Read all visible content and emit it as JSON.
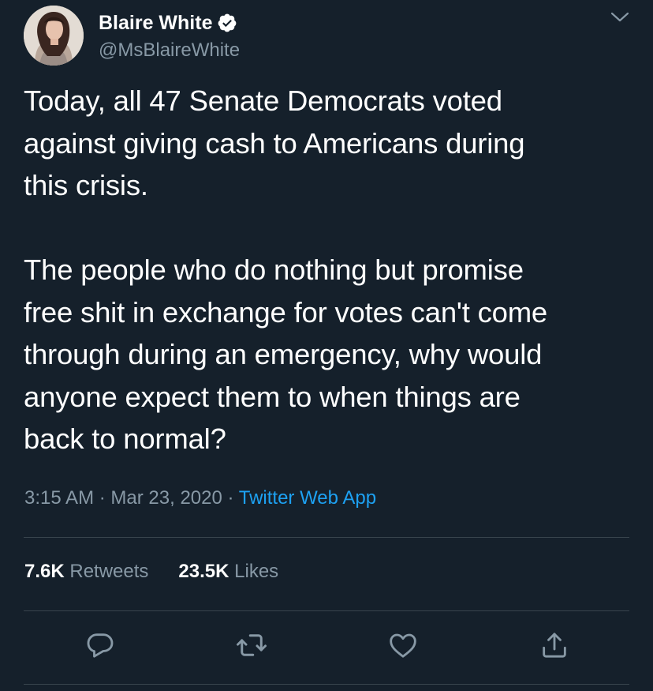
{
  "user": {
    "display_name": "Blaire White",
    "handle": "@MsBlaireWhite",
    "verified": true,
    "avatar": "profile-photo"
  },
  "tweet": {
    "text": "Today, all 47 Senate Democrats voted\nagainst giving cash to Americans during\nthis crisis.\n\nThe people who do nothing but promise\nfree shit in exchange for votes can't come\nthrough during an emergency, why would\nanyone expect them to when things are\nback to normal?",
    "time": "3:15 AM",
    "separator": "·",
    "date": "Mar 23, 2020",
    "source": "Twitter Web App"
  },
  "stats": {
    "retweets_count": "7.6K",
    "retweets_label": "Retweets",
    "likes_count": "23.5K",
    "likes_label": "Likes"
  },
  "actions": {
    "reply_icon": "reply-icon",
    "retweet_icon": "retweet-icon",
    "like_icon": "heart-icon",
    "share_icon": "share-icon"
  },
  "colors": {
    "background": "#15202b",
    "text": "#ffffff",
    "secondary": "#8899a6",
    "accent": "#1da1f2",
    "divider": "#38444d"
  }
}
